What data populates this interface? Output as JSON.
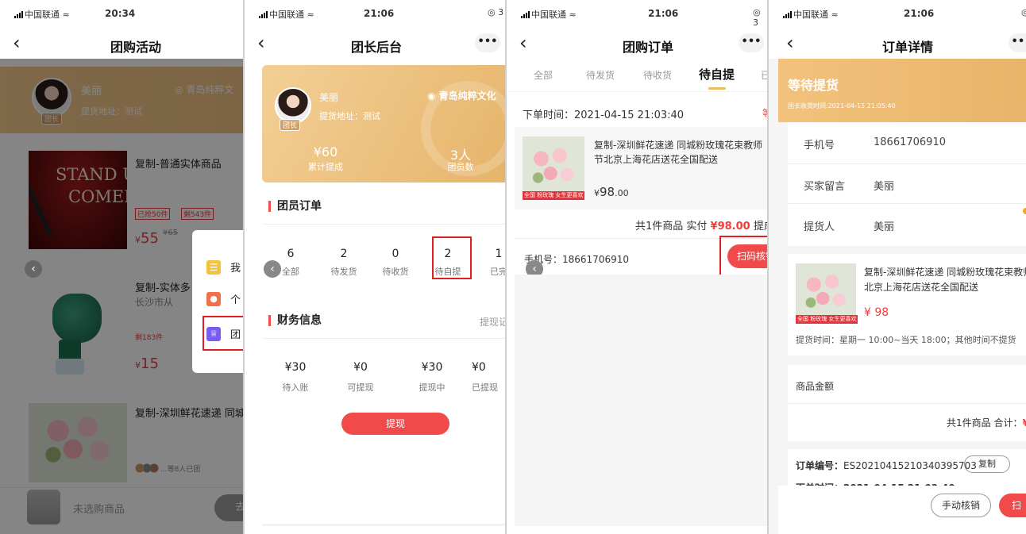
{
  "status": {
    "carrier": "中国联通"
  },
  "colors": {
    "accent_red": "#f23b3b",
    "gold": "#e8b56a",
    "pink_btn": "#f04a4a"
  },
  "icons": {
    "back": "chevron-left-icon",
    "more": "more-dots-icon",
    "location": "location-pin-icon",
    "wifi": "wifi-icon",
    "bag": "shopping-bag-icon"
  },
  "screen1": {
    "time": "20:34",
    "title": "团购活动",
    "leader": {
      "name": "美丽",
      "tag": "团长",
      "address": "提货地址：测试",
      "location": "青岛纯粹文"
    },
    "products": [
      {
        "name": "复制-普通实体商品",
        "sold": "已抢50件",
        "left": "剩543件",
        "price": "55",
        "orig_price": "¥65",
        "image_text_1": "STAND U",
        "image_text_2": "COMED"
      },
      {
        "name": "复制-实体多",
        "sub": "长沙市从",
        "left": "剩183件",
        "price": "15"
      },
      {
        "name": "复制-深圳鲜花速递 同城",
        "joined": "...等8人已团"
      }
    ],
    "currency": "¥",
    "popup": [
      {
        "icon": "list-icon",
        "label": "我"
      },
      {
        "icon": "person-icon",
        "label": "个"
      },
      {
        "icon": "crown-icon",
        "label": "团"
      }
    ],
    "cart": {
      "empty_text": "未选购商品",
      "button": "去"
    }
  },
  "screen2": {
    "time": "21:06",
    "battery": "3",
    "title": "团长后台",
    "leader": {
      "name": "美丽",
      "tag": "团长",
      "address": "提货地址：测试",
      "location": "青岛纯粹文化"
    },
    "summary": [
      {
        "value": "¥60",
        "label": "累计提成"
      },
      {
        "value": "3人",
        "label": "团员数"
      }
    ],
    "orders_title": "团员订单",
    "order_stats": [
      {
        "n": "6",
        "label": "全部"
      },
      {
        "n": "2",
        "label": "待发货"
      },
      {
        "n": "0",
        "label": "待收货"
      },
      {
        "n": "2",
        "label": "待自提"
      },
      {
        "n": "1",
        "label": "已完"
      }
    ],
    "finance_title": "财务信息",
    "finance_link": "提现记",
    "finance": [
      {
        "value": "¥30",
        "label": "待入账"
      },
      {
        "value": "¥0",
        "label": "可提现"
      },
      {
        "value": "¥30",
        "label": "提现中"
      },
      {
        "value": "¥0",
        "label": "已提现"
      }
    ],
    "withdraw_button": "提现"
  },
  "screen3": {
    "time": "21:06",
    "battery": "3",
    "title": "团购订单",
    "tabs": [
      "全部",
      "待发货",
      "待收货",
      "待自提",
      "已"
    ],
    "active_tab": "待自提",
    "order_time": "下单时间：2021-04-15 21:03:40",
    "order_status": "等",
    "product_name": "复制-深圳鲜花速递 同城粉玫瑰花束教师节北京上海花店送花全国配送",
    "price_int": "98",
    "price_dec": ".00",
    "currency": "¥",
    "summary_prefix": "共1件商品 实付 ",
    "summary_amount": "¥98.00",
    "summary_suffix": " 提成",
    "phone": "手机号：18661706910",
    "scan_button": "扫码核销"
  },
  "screen4": {
    "time": "21:06",
    "title": "订单详情",
    "banner_title": "等待提货",
    "banner_sub": "团长收货时间:2021-04-15 21:05:40",
    "info_rows": [
      {
        "label": "手机号",
        "value": "18661706910"
      },
      {
        "label": "买家留言",
        "value": "美丽"
      },
      {
        "label": "提货人",
        "value": "美丽"
      }
    ],
    "product_name": "复制-深圳鲜花速递 同城粉玫瑰花束教师节北京上海花店送花全国配送",
    "price": "¥ 98",
    "pickup_time": "提货时间：星期一 10:00~当天 18:00；其他时间不提货",
    "amount_label": "商品金额",
    "amount_value": "¥",
    "total_prefix": "共1件商品 合计：",
    "total_value": "¥",
    "order_no_label": "订单编号：",
    "order_no": "ES20210415210340395703",
    "copy_button": "复制",
    "order_time_cut": "下单时间：2021-04-15 21:03:40",
    "manual_button": "手动核销",
    "scan_button": "扫"
  },
  "flower_tag": "全国 粉玫瑰 女生更喜欢"
}
